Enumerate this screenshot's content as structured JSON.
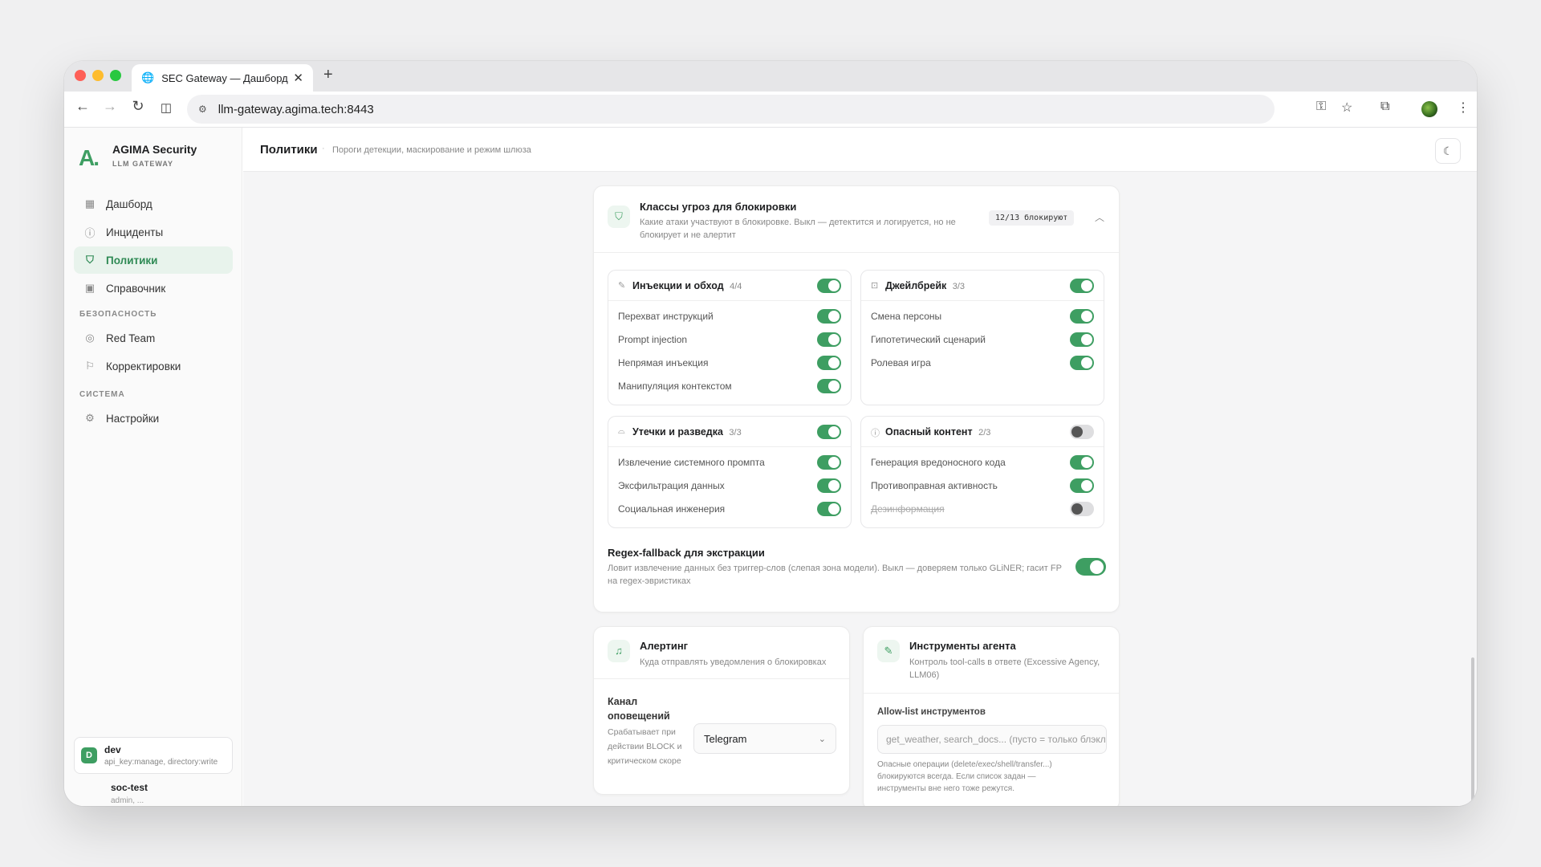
{
  "browser": {
    "tab_title": "SEC Gateway — Дашборд",
    "url": "llm-gateway.agima.tech:8443"
  },
  "sidebar": {
    "brand": "AGIMA Security",
    "brand_sub": "LLM GATEWAY",
    "items": [
      {
        "label": "Дашборд"
      },
      {
        "label": "Инциденты"
      },
      {
        "label": "Политики"
      },
      {
        "label": "Справочник"
      }
    ],
    "section_security": "БЕЗОПАСНОСТЬ",
    "security_items": [
      {
        "label": "Red Team"
      },
      {
        "label": "Корректировки"
      }
    ],
    "section_system": "СИСТЕМА",
    "system_items": [
      {
        "label": "Настройки"
      }
    ],
    "accounts": [
      {
        "initial": "D",
        "name": "dev",
        "scopes": "api_key:manage, directory:write"
      },
      {
        "name": "soc-test",
        "scopes": "admin, ..."
      }
    ]
  },
  "header": {
    "title": "Политики",
    "sep": "·",
    "subtitle": "Пороги детекции, маскирование и режим шлюза"
  },
  "threats": {
    "title": "Классы угроз для блокировки",
    "desc": "Какие атаки участвуют в блокировке. Выкл — детектится и логируется, но не блокирует и не алертит",
    "badge": "12/13 блокируют",
    "groups": [
      {
        "title": "Инъекции и обход",
        "count": "4/4",
        "enabled": true,
        "items": [
          {
            "label": "Перехват инструкций",
            "on": true
          },
          {
            "label": "Prompt injection",
            "on": true
          },
          {
            "label": "Непрямая инъекция",
            "on": true
          },
          {
            "label": "Манипуляция контекстом",
            "on": true
          }
        ]
      },
      {
        "title": "Джейлбрейк",
        "count": "3/3",
        "enabled": true,
        "items": [
          {
            "label": "Смена персоны",
            "on": true
          },
          {
            "label": "Гипотетический сценарий",
            "on": true
          },
          {
            "label": "Ролевая игра",
            "on": true
          }
        ]
      },
      {
        "title": "Утечки и разведка",
        "count": "3/3",
        "enabled": true,
        "items": [
          {
            "label": "Извлечение системного промпта",
            "on": true
          },
          {
            "label": "Эксфильтрация данных",
            "on": true
          },
          {
            "label": "Социальная инженерия",
            "on": true
          }
        ]
      },
      {
        "title": "Опасный контент",
        "count": "2/3",
        "enabled": false,
        "items": [
          {
            "label": "Генерация вредоносного кода",
            "on": true
          },
          {
            "label": "Противоправная активность",
            "on": true
          },
          {
            "label": "Дезинформация",
            "on": false
          }
        ]
      }
    ],
    "regex_title": "Regex-fallback для экстракции",
    "regex_desc": "Ловит извлечение данных без триггер-слов (слепая зона модели). Выкл — доверяем только GLiNER; гасит FP на regex-эвристиках",
    "regex_on": true
  },
  "alerting": {
    "title": "Алертинг",
    "desc": "Куда отправлять уведомления о блокировках",
    "channel_label": "Канал оповещений",
    "channel_hint": "Срабатывает при действии BLOCK и критическом скоре",
    "channel_value": "Telegram"
  },
  "tools": {
    "title": "Инструменты агента",
    "desc": "Контроль tool-calls в ответе (Excessive Agency, LLM06)",
    "allow_label": "Allow-list инструментов",
    "allow_placeholder": "get_weather, search_docs... (пусто = только блэклист)",
    "allow_hint": "Опасные операции (delete/exec/shell/transfer...) блокируются всегда. Если список задан — инструменты вне него тоже режутся."
  },
  "colors": {
    "accent": "#3e9e62",
    "accent_bg": "#e8f3ec"
  }
}
